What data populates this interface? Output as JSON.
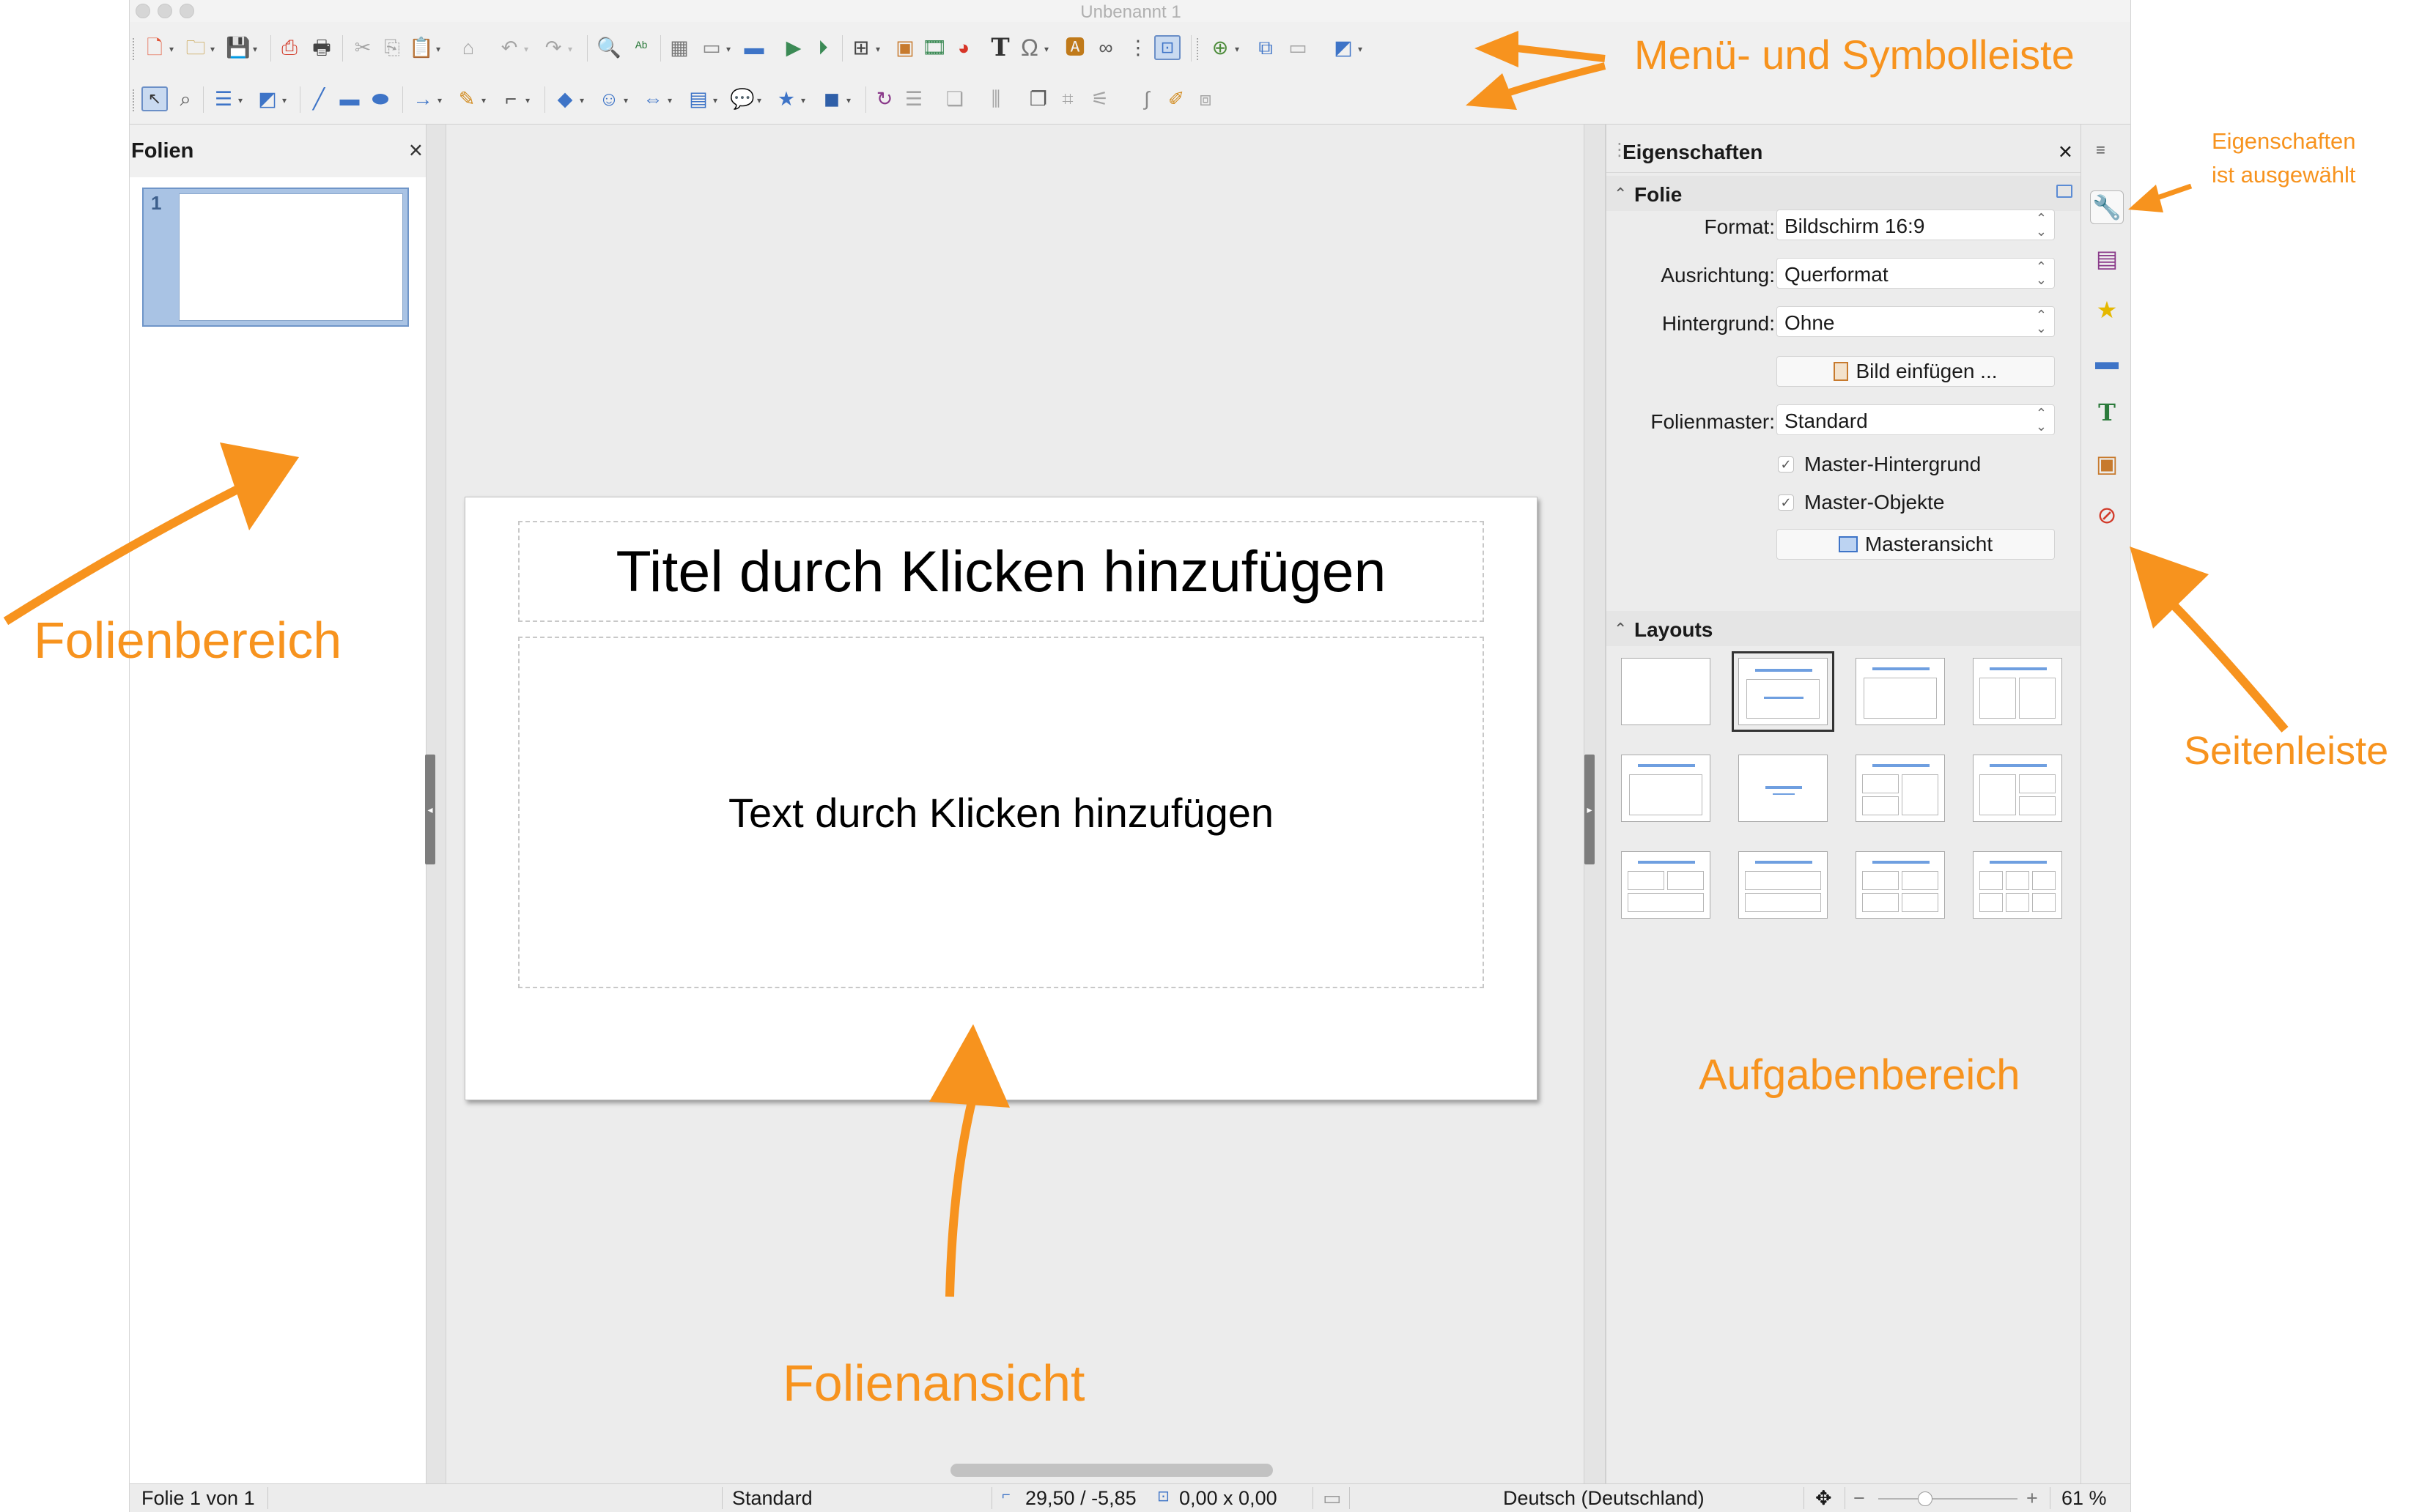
{
  "window": {
    "title": "Unbenannt 1"
  },
  "toolbar": {
    "row1_icons": [
      "new-document-icon",
      "open-folder-icon",
      "save-icon",
      "export-pdf-icon",
      "print-icon",
      "cut-icon",
      "copy-icon",
      "paste-icon",
      "clone-formatting-icon",
      "undo-icon",
      "redo-icon",
      "find-replace-icon",
      "spellcheck-icon",
      "grid-icon",
      "display-views-icon",
      "start-presentation-icon",
      "presentation-from-slide-icon",
      "insert-table-icon",
      "insert-image-icon",
      "insert-media-icon",
      "insert-chart-icon",
      "insert-textbox-icon",
      "special-character-icon",
      "fontwork-icon",
      "hyperlink-icon",
      "snap-icon",
      "helplines-icon",
      "new-slide-icon",
      "duplicate-slide-icon",
      "delete-slide-icon",
      "slide-layout-icon"
    ],
    "row2_icons": [
      "select-icon",
      "zoom-pan-icon",
      "line-color-icon",
      "fill-color-icon",
      "line-icon",
      "rectangle-icon",
      "ellipse-icon",
      "arrow-line-icon",
      "curve-icon",
      "connector-icon",
      "basic-shapes-icon",
      "symbol-shapes-icon",
      "block-arrows-icon",
      "flowchart-icon",
      "callouts-icon",
      "stars-icon",
      "3d-objects-icon",
      "rotate-icon",
      "align-icon",
      "arrange-icon",
      "distribute-icon",
      "shadow-icon",
      "crop-icon",
      "filter-icon",
      "points-icon",
      "glue-points-icon",
      "toggle-extrusion-icon"
    ]
  },
  "slide_pane": {
    "title": "Folien",
    "close": "×",
    "thumbnails": [
      {
        "number": "1"
      }
    ]
  },
  "slide": {
    "title_placeholder": "Titel durch Klicken hinzufügen",
    "text_placeholder": "Text durch Klicken hinzufügen"
  },
  "task_pane": {
    "title": "Eigenschaften",
    "close": "×",
    "folie": {
      "heading": "Folie",
      "format_label": "Format:",
      "format_value": "Bildschirm 16:9",
      "orientation_label": "Ausrichtung:",
      "orientation_value": "Querformat",
      "background_label": "Hintergrund:",
      "background_value": "Ohne",
      "insert_image_button": "Bild einfügen ...",
      "master_label": "Folienmaster:",
      "master_value": "Standard",
      "master_background_check": "Master-Hintergrund",
      "master_objects_check": "Master-Objekte",
      "master_view_button": "Masteransicht"
    },
    "layouts": {
      "heading": "Layouts"
    }
  },
  "sidebar_tabs": [
    {
      "icon": "properties-icon",
      "active": true
    },
    {
      "icon": "slide-transition-icon"
    },
    {
      "icon": "animation-icon"
    },
    {
      "icon": "master-slides-icon"
    },
    {
      "icon": "styles-icon"
    },
    {
      "icon": "gallery-icon"
    },
    {
      "icon": "navigator-icon"
    }
  ],
  "statusbar": {
    "slide_info": "Folie 1 von 1",
    "master": "Standard",
    "position": "29,50 / -5,85",
    "size": "0,00 x 0,00",
    "language": "Deutsch (Deutschland)",
    "zoom": "61 %"
  },
  "annotations": {
    "menu_toolbar": "Menü- und Symbolleiste",
    "properties_selected_line1": "Eigenschaften",
    "properties_selected_line2": "ist ausgewählt",
    "slide_area": "Folienbereich",
    "sidebar": "Seitenleiste",
    "task_area": "Aufgabenbereich",
    "slide_view": "Folienansicht"
  },
  "colors": {
    "annotation": "#f7931e",
    "selection_blue": "#6f95c8"
  }
}
